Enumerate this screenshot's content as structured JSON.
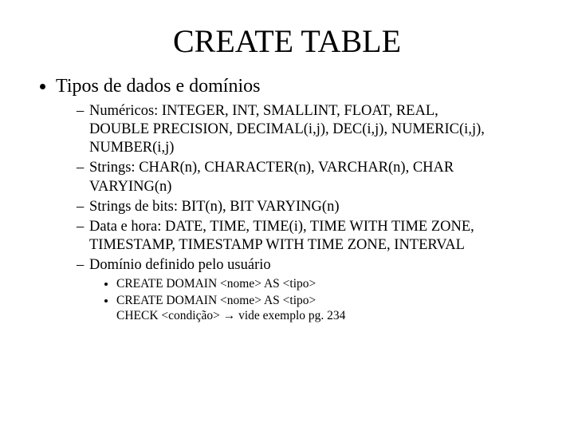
{
  "title": "CREATE TABLE",
  "bullet1": "Tipos de dados e domínios",
  "sub": {
    "num_l1": "Numéricos: INTEGER, INT, SMALLINT, FLOAT, REAL,",
    "num_l2": "DOUBLE PRECISION, DECIMAL(i,j), DEC(i,j), NUMERIC(i,j),",
    "num_l3": "NUMBER(i,j)",
    "str_l1": "Strings: CHAR(n), CHARACTER(n), VARCHAR(n), CHAR",
    "str_l2": "VARYING(n)",
    "bits": "Strings de bits: BIT(n), BIT VARYING(n)",
    "date_l1": "Data e hora: DATE, TIME, TIME(i), TIME WITH TIME ZONE,",
    "date_l2": "TIMESTAMP, TIMESTAMP WITH TIME ZONE, INTERVAL",
    "domain": "Domínio definido pelo usuário"
  },
  "subsub": {
    "cd1": "CREATE DOMAIN <nome> AS <tipo>",
    "cd2_l1": "CREATE DOMAIN <nome> AS <tipo>",
    "cd2_l2": "CHECK <condição> → vide exemplo pg. 234"
  }
}
